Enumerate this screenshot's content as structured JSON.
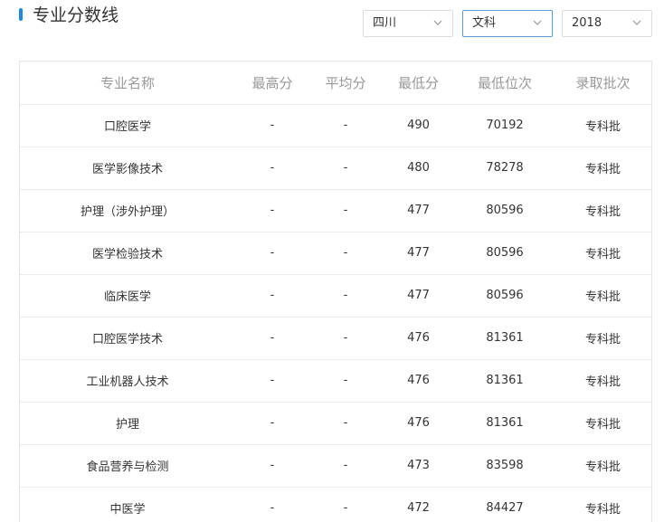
{
  "header": {
    "title": "专业分数线"
  },
  "filters": {
    "province": "四川",
    "subject": "文科",
    "year": "2018"
  },
  "table": {
    "columns": [
      "专业名称",
      "最高分",
      "平均分",
      "最低分",
      "最低位次",
      "录取批次"
    ],
    "rows": [
      [
        "口腔医学",
        "-",
        "-",
        "490",
        "70192",
        "专科批"
      ],
      [
        "医学影像技术",
        "-",
        "-",
        "480",
        "78278",
        "专科批"
      ],
      [
        "护理（涉外护理）",
        "-",
        "-",
        "477",
        "80596",
        "专科批"
      ],
      [
        "医学检验技术",
        "-",
        "-",
        "477",
        "80596",
        "专科批"
      ],
      [
        "临床医学",
        "-",
        "-",
        "477",
        "80596",
        "专科批"
      ],
      [
        "口腔医学技术",
        "-",
        "-",
        "476",
        "81361",
        "专科批"
      ],
      [
        "工业机器人技术",
        "-",
        "-",
        "476",
        "81361",
        "专科批"
      ],
      [
        "护理",
        "-",
        "-",
        "476",
        "81361",
        "专科批"
      ],
      [
        "食品营养与检测",
        "-",
        "-",
        "473",
        "83598",
        "专科批"
      ],
      [
        "中医学",
        "-",
        "-",
        "472",
        "84427",
        "专科批"
      ]
    ]
  }
}
